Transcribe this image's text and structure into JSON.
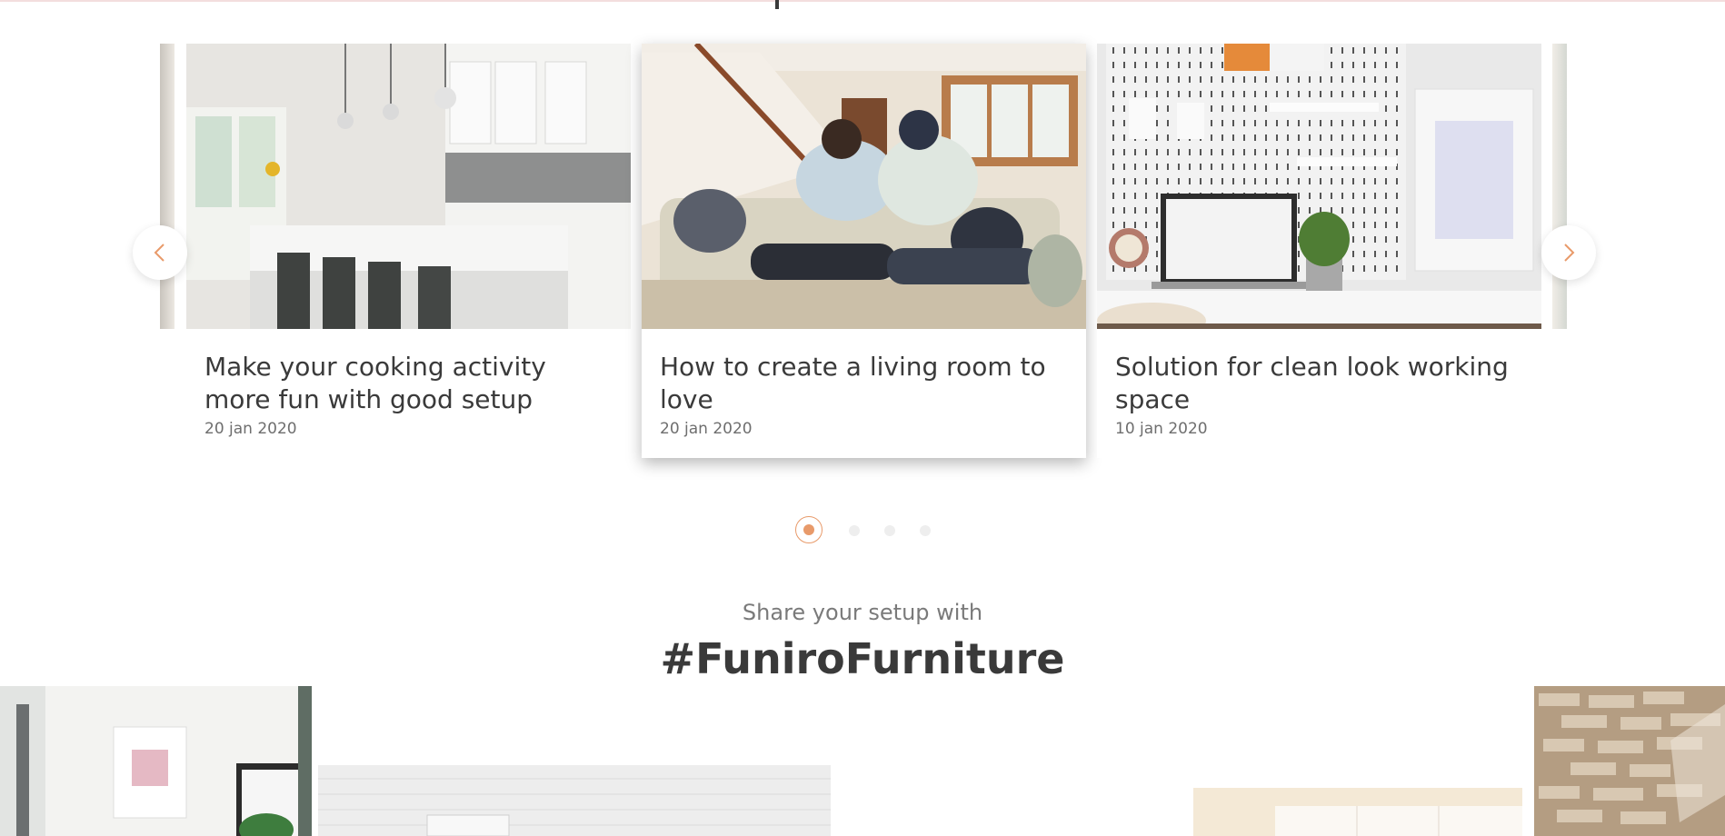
{
  "carousel": {
    "prev_label": "‹",
    "next_label": "›",
    "cards": [
      {
        "title": "Make your cooking activity more fun with good setup",
        "date": "20 jan 2020",
        "image": "kitchen-photo"
      },
      {
        "title": "How to create a living room to love",
        "date": "20 jan 2020",
        "image": "living-room-photo"
      },
      {
        "title": "Solution for clean look working space",
        "date": "10 jan 2020",
        "image": "workspace-photo"
      }
    ],
    "pagination": {
      "total": 4,
      "active": 0
    }
  },
  "share": {
    "subtitle": "Share your setup with",
    "title": "#FuniroFurniture"
  },
  "colors": {
    "accent": "#e89a6a",
    "text": "#3a3a3a",
    "muted": "#6e6e6e"
  }
}
